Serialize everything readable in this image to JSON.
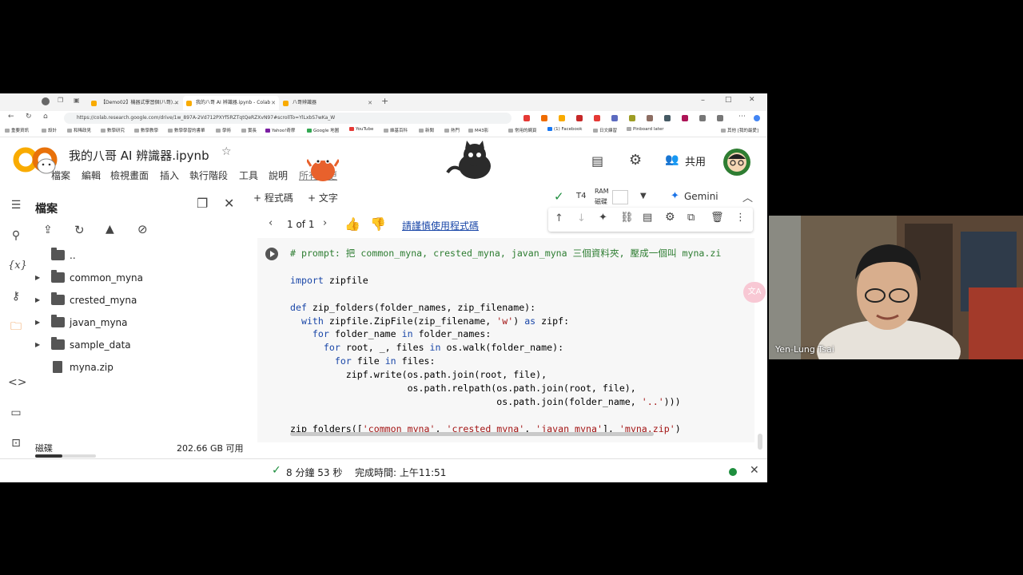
{
  "browser": {
    "tabs": [
      {
        "label": "【Demo02】機器式學習個(八哥)..."
      },
      {
        "label": "我的八哥 AI 辨識器.ipynb - Colab"
      },
      {
        "label": "八哥辨識器"
      }
    ],
    "url": "https://colab.research.google.com/drive/1w_897A-2Vd712PXYf5RZTqtQeRZXvN97#scrollTo=YlLxbS7wKa_W",
    "bookmarks": [
      "重要資訊",
      "設計",
      "和稀政見",
      "數學研究",
      "數學教學",
      "數學學習的書單",
      "學術",
      "實長",
      "Yahoo!奇摩",
      "Google 地圖",
      "YouTube",
      "維基百科",
      "新聞",
      "熱門",
      "M43影",
      "常用的網頁",
      "(1) Facebook",
      "日文練習",
      "Pinboard later",
      "其他 [我的最愛]"
    ]
  },
  "colab": {
    "filename": "我的八哥 AI 辨識器.ipynb",
    "menu": [
      "檔案",
      "編輯",
      "檢視畫面",
      "插入",
      "執行階段",
      "工具",
      "說明"
    ],
    "save_note": "所有變更",
    "share_label": "共用",
    "toolbar": {
      "add_code": "+ 程式碼",
      "add_text": "+ 文字",
      "runtime": "T4",
      "ram_label": "RAM",
      "disk_label": "磁碟",
      "gemini": "Gemini"
    }
  },
  "files": {
    "title": "檔案",
    "items": [
      {
        "name": "..",
        "type": "parent"
      },
      {
        "name": "common_myna",
        "type": "folder"
      },
      {
        "name": "crested_myna",
        "type": "folder"
      },
      {
        "name": "javan_myna",
        "type": "folder"
      },
      {
        "name": "sample_data",
        "type": "folder"
      },
      {
        "name": "myna.zip",
        "type": "file"
      }
    ],
    "disk_label": "磁碟",
    "disk_free": "202.66 GB 可用",
    "disk_used_fraction": 0.45
  },
  "cell": {
    "pager": "1 of 1",
    "warning_link": "請謹慎使用程式碼",
    "code_lines": [
      "# prompt: 把 common_myna, crested_myna, javan_myna 三個資料夾, 壓成一個叫 myna.zi",
      "",
      "import zipfile",
      "",
      "def zip_folders(folder_names, zip_filename):",
      "  with zipfile.ZipFile(zip_filename, 'w') as zipf:",
      "    for folder_name in folder_names:",
      "      for root, _, files in os.walk(folder_name):",
      "        for file in files:",
      "          zipf.write(os.path.join(root, file),",
      "                     os.path.relpath(os.path.join(root, file),",
      "                                     os.path.join(folder_name, '..')))",
      "",
      "zip_folders(['common_myna', 'crested_myna', 'javan_myna'], 'myna.zip')"
    ]
  },
  "status": {
    "duration": "8 分鐘 53 秒",
    "completed": "完成時間: 上午11:51"
  },
  "video": {
    "speaker": "Yen-Lung Tsai"
  },
  "colors": {
    "accent_blue": "#1a47a8",
    "gemini_blue": "#1a73e8",
    "status_green": "#1e8e3e"
  }
}
